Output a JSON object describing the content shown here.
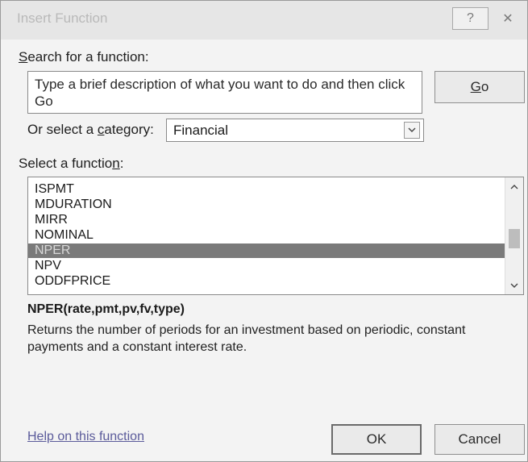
{
  "window": {
    "title": "Insert Function",
    "help_glyph": "?",
    "close_glyph": "✕"
  },
  "search": {
    "label_key": "S",
    "label_rest": "earch for a function:",
    "value": "Type a brief description of what you want to do and then click Go",
    "go_key": "G",
    "go_rest": "o"
  },
  "category": {
    "label_pre": "Or select a ",
    "label_key": "c",
    "label_post": "ategory:",
    "selected": "Financial"
  },
  "function_list": {
    "label_pre": "Select a functio",
    "label_key": "n",
    "label_post": ":",
    "items": [
      "ISPMT",
      "MDURATION",
      "MIRR",
      "NOMINAL",
      "NPER",
      "NPV",
      "ODDFPRICE"
    ],
    "selected_index": 4
  },
  "details": {
    "syntax": "NPER(rate,pmt,pv,fv,type)",
    "description": "Returns the number of periods for an investment based on periodic, constant payments and a constant interest rate."
  },
  "footer": {
    "help_link": "Help on this function",
    "ok_label": "OK",
    "cancel_label": "Cancel"
  },
  "colors": {
    "selection_bg": "#7a7a7a",
    "dialog_bg": "#f3f3f3"
  },
  "icons": {
    "help": "question-mark-icon",
    "close": "close-icon",
    "dropdown": "chevron-down-icon",
    "scroll_up": "chevron-up-icon",
    "scroll_down": "chevron-down-icon"
  }
}
